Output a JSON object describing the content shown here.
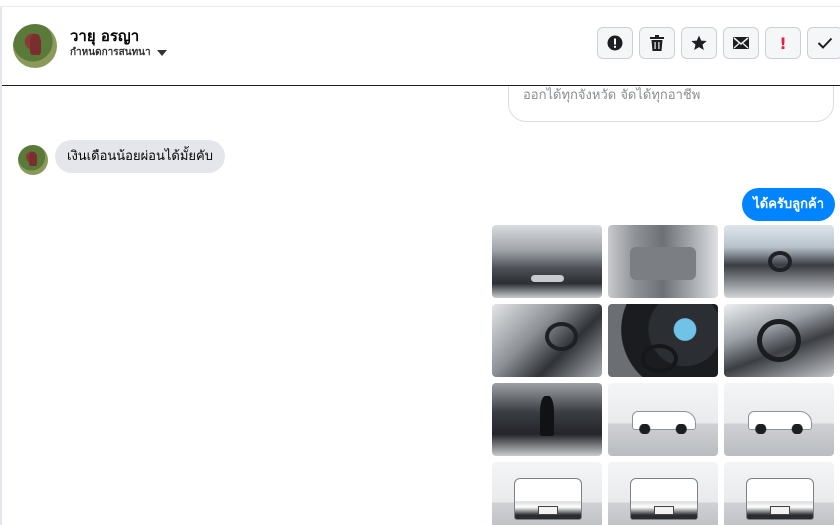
{
  "header": {
    "contact_name": "วายุ อรญา",
    "label_dropdown": "กำหนดการสนทนา",
    "actions": [
      {
        "name": "alert-circle-icon"
      },
      {
        "name": "trash-icon"
      },
      {
        "name": "star-icon"
      },
      {
        "name": "mail-icon"
      },
      {
        "name": "exclamation-icon"
      },
      {
        "name": "check-icon"
      }
    ]
  },
  "thread": {
    "previous_message": "ออกได้ทุกจังหวัด จัดได้ทุกอาชีพ",
    "incoming_message": "เงินเดือนน้อยผ่อนได้มั้ยคับ",
    "outgoing_message": "ได้ครับลูกค้า",
    "photos": [
      {
        "label": "engine-bay-photo"
      },
      {
        "label": "rear-seats-photo"
      },
      {
        "label": "dashboard-photo"
      },
      {
        "label": "driver-door-photo"
      },
      {
        "label": "instrument-cluster-photo"
      },
      {
        "label": "steering-wheel-photo"
      },
      {
        "label": "gear-shifter-photo"
      },
      {
        "label": "truck-side-photo"
      },
      {
        "label": "truck-side-photo-2"
      },
      {
        "label": "truck-rear-photo"
      },
      {
        "label": "truck-rear-photo-2"
      },
      {
        "label": "truck-rear-photo-3"
      }
    ]
  },
  "colors": {
    "outgoing_bubble": "#0084ff",
    "incoming_bubble": "#e4e6eb",
    "alert_red": "#e41e3f"
  }
}
